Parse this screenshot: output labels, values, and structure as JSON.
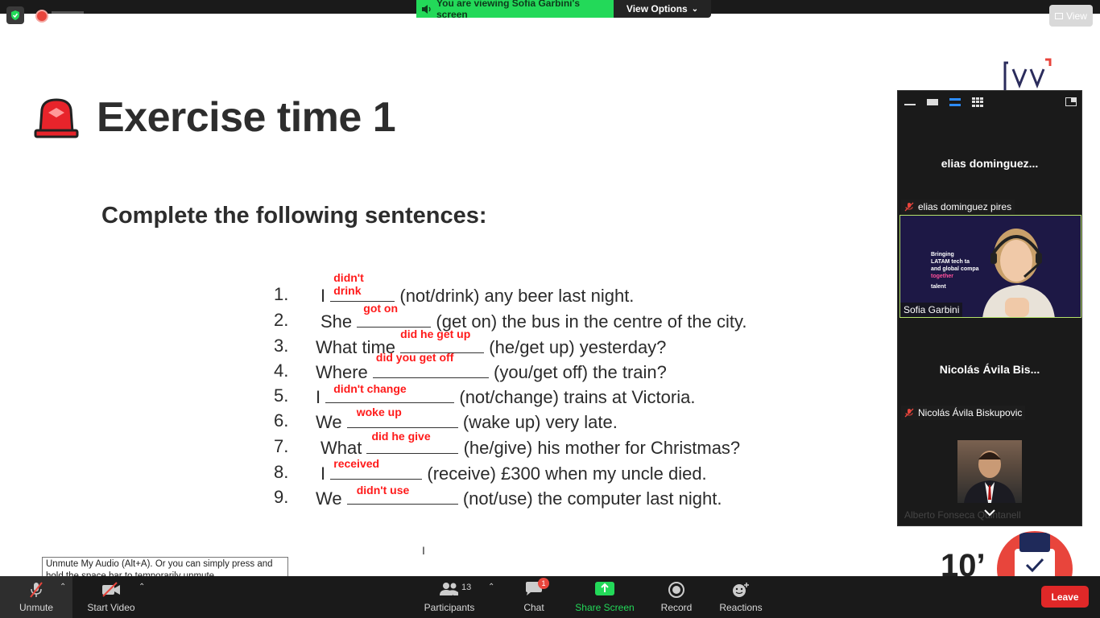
{
  "top_bar": {
    "viewing_banner": "You are viewing Sofia Garbini's screen",
    "view_options_label": "View Options",
    "view_button_label": "View"
  },
  "slide": {
    "title": "Exercise time 1",
    "subtitle": "Complete the following sentences:",
    "exercises": [
      {
        "num": "1.",
        "before": "I",
        "answer": "didn't drink",
        "after": "(not/drink) any beer last night."
      },
      {
        "num": "2.",
        "before": "She",
        "answer": "got on",
        "after": "(get on) the bus in the centre of the city."
      },
      {
        "num": "3.",
        "before": "What time",
        "answer": "did he get up",
        "after": "(he/get up) yesterday?"
      },
      {
        "num": "4.",
        "before": "Where",
        "answer": "did you get off",
        "after": "(you/get off) the train?"
      },
      {
        "num": "5.",
        "before": "I",
        "answer": "didn't change",
        "after": "(not/change) trains at Victoria."
      },
      {
        "num": "6.",
        "before": "We",
        "answer": "woke up",
        "after": "(wake up) very late."
      },
      {
        "num": "7.",
        "before": "What",
        "answer": "did he give",
        "after": "(he/give) his mother for Christmas?"
      },
      {
        "num": "8.",
        "before": "I",
        "answer": "received",
        "after": "(receive) £300 when my uncle died."
      },
      {
        "num": "9.",
        "before": "We",
        "answer": "didn't use",
        "after": "(not/use) the computer last night."
      }
    ],
    "countdown": "10’",
    "logo_text": "[\\/]"
  },
  "participants_panel": {
    "tiles": [
      {
        "big_name": "elias  dominguez...",
        "label": "elias dominguez pires"
      },
      {
        "video_label": "Sofia Garbini",
        "video_text": [
          "Bringing",
          "LATAM tech ta",
          "and global compa",
          "together",
          "talent"
        ]
      },
      {
        "big_name": "Nicolás Ávila Bis...",
        "label": "Nicolás Ávila Biskupovic"
      },
      {
        "faded_name": "Alberto Fonseca Quintanell"
      }
    ]
  },
  "tooltip": {
    "text_line1": "Unmute My Audio (Alt+A). Or you can simply press and",
    "text_line2": "hold the space bar to temporarily unmute."
  },
  "toolbar": {
    "unmute_label": "Unmute",
    "start_video_label": "Start Video",
    "participants_label": "Participants",
    "participants_count": "13",
    "chat_label": "Chat",
    "chat_badge": "1",
    "share_screen_label": "Share Screen",
    "record_label": "Record",
    "reactions_label": "Reactions",
    "leave_label": "Leave"
  },
  "colors": {
    "answer_red": "#ff1a1a",
    "share_green": "#23d959",
    "leave_red": "#e02828",
    "toolbar_bg": "#1a1a1a"
  }
}
